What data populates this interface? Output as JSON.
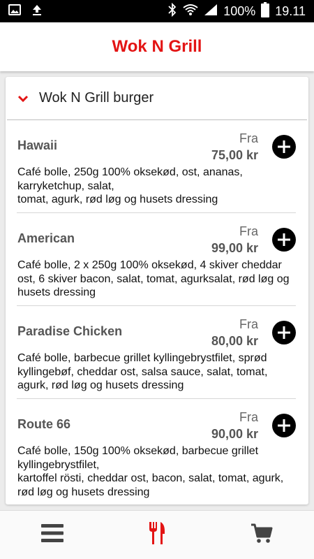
{
  "status_bar": {
    "battery_percent": "100%",
    "time": "19.11",
    "icons": [
      "image-icon",
      "upload-icon",
      "bluetooth-icon",
      "wifi-icon",
      "signal-icon",
      "battery-icon"
    ]
  },
  "app_bar": {
    "title": "Wok N Grill"
  },
  "section": {
    "title": "Wok N Grill burger",
    "expanded": true
  },
  "items": [
    {
      "name": "Hawaii",
      "price_prefix": "Fra",
      "price": "75,00 kr",
      "desc_lines": [
        "Café bolle, 250g 100% oksekød, ost, ananas,",
        "karryketchup, salat,",
        "tomat, agurk, rød løg og husets dressing"
      ]
    },
    {
      "name": "American",
      "price_prefix": "Fra",
      "price": "99,00 kr",
      "desc_lines": [
        "Café bolle, 2 x 250g 100% oksekød, 4 skiver cheddar",
        "ost, 6 skiver bacon, salat, tomat, agurksalat, rød løg og",
        "husets dressing"
      ]
    },
    {
      "name": "Paradise Chicken",
      "price_prefix": "Fra",
      "price": "80,00 kr",
      "desc_lines": [
        "Café bolle, barbecue grillet kyllingebrystfilet, sprød",
        "kyllingebøf, cheddar ost, salsa sauce, salat, tomat,",
        "agurk, rød løg og husets dressing"
      ]
    },
    {
      "name": "Route 66",
      "price_prefix": "Fra",
      "price": "90,00 kr",
      "desc_lines": [
        "Café bolle, 150g 100% oksekød, barbecue grillet",
        "kyllingebrystfilet,",
        "kartoffel rösti, cheddar ost, bacon, salat, tomat, agurk,",
        "rød løg og husets dressing"
      ]
    }
  ],
  "bottom_nav": {
    "items": [
      {
        "icon": "menu-icon",
        "active": false
      },
      {
        "icon": "cutlery-icon",
        "active": true
      },
      {
        "icon": "cart-icon",
        "active": false
      }
    ]
  },
  "colors": {
    "accent": "#e31414",
    "status_bar": "#000000",
    "text_dark": "#111111",
    "text_muted": "#555555"
  }
}
